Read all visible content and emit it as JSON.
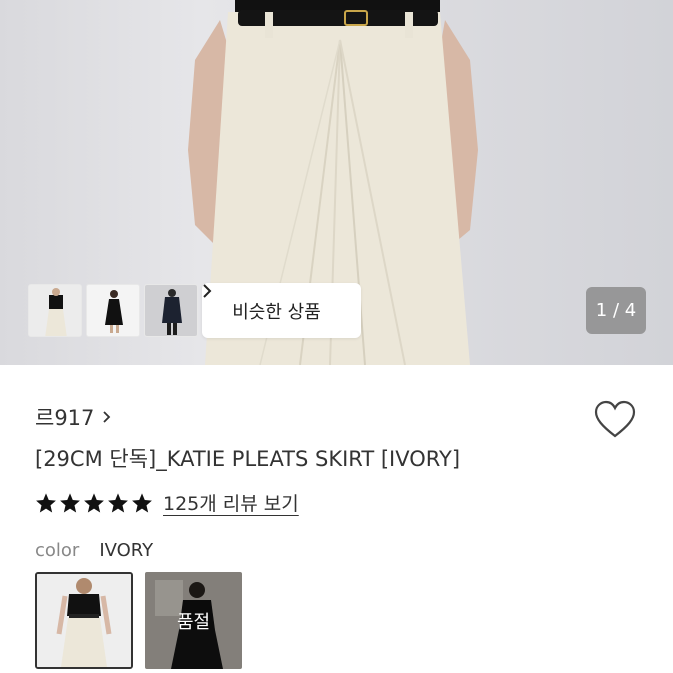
{
  "hero": {
    "similar_button_label": "비슷한 상품",
    "counter": "1 / 4",
    "thumbnails": [
      "outfit-thumbnail",
      "black-dress-thumbnail",
      "coat-thumbnail"
    ]
  },
  "product": {
    "brand": "르917",
    "title": "[29CM 단독]_KATIE PLEATS SKIRT [IVORY]",
    "rating_stars": 5,
    "review_link": "125개 리뷰 보기"
  },
  "options": {
    "color_label": "color",
    "color_value": "IVORY",
    "sold_out_label": "품절"
  },
  "colors": {
    "skirt": "#ece7d9",
    "wall": "#dcdce0",
    "text": "#333333",
    "star": "#111111"
  }
}
